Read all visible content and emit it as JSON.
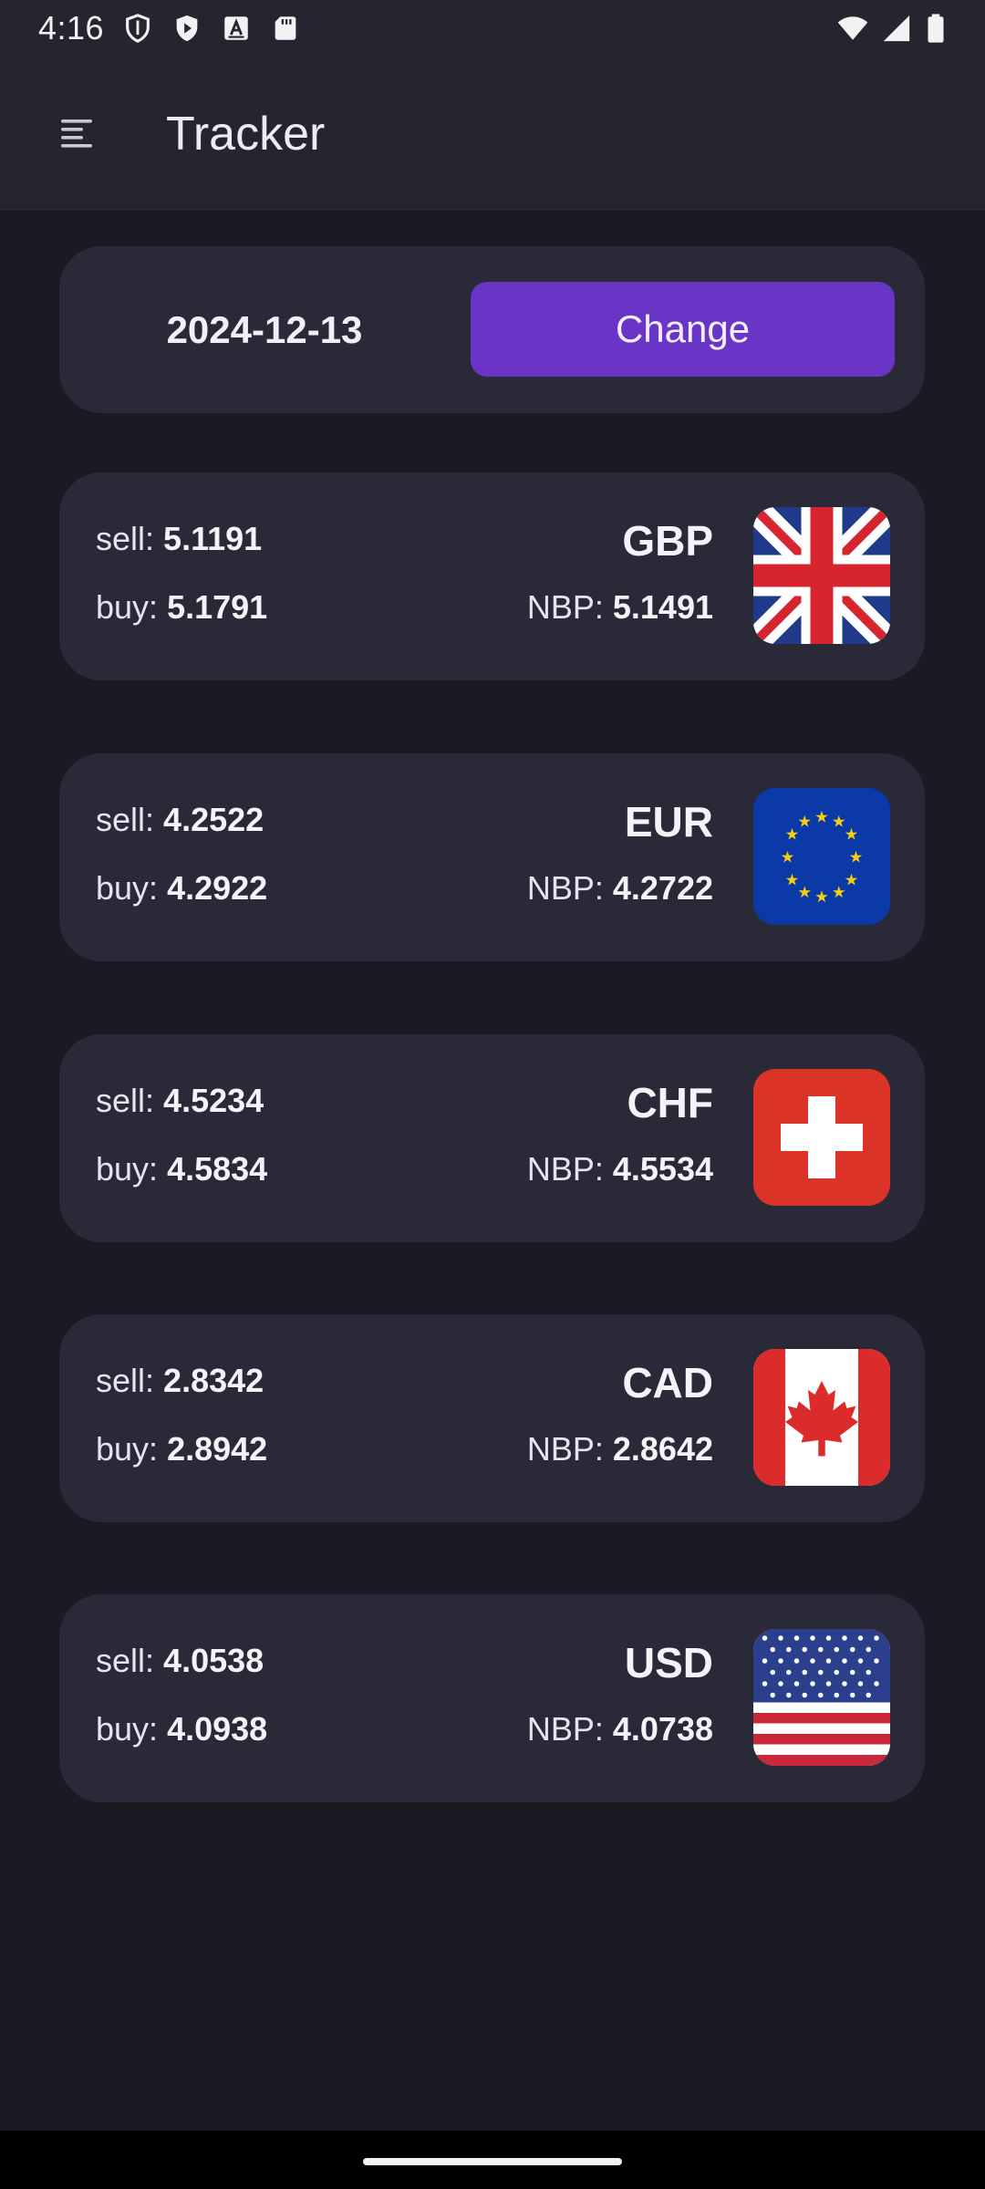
{
  "status_bar": {
    "time": "4:16",
    "left_icons": [
      "shield-icon",
      "play-store-icon",
      "font-a-icon",
      "sd-card-icon"
    ],
    "right_icons": [
      "wifi-icon",
      "signal-icon",
      "battery-icon"
    ]
  },
  "app_bar": {
    "menu_icon": "menu-icon",
    "title": "Tracker"
  },
  "date_selector": {
    "date": "2024-12-13",
    "change_label": "Change",
    "button_color": "#6a35c6"
  },
  "labels": {
    "sell": "sell:",
    "buy": "buy:",
    "nbp": "NBP:"
  },
  "currencies": [
    {
      "code": "GBP",
      "sell": "5.1191",
      "buy": "5.1791",
      "nbp": "5.1491",
      "flag": "uk-flag-icon"
    },
    {
      "code": "EUR",
      "sell": "4.2522",
      "buy": "4.2922",
      "nbp": "4.2722",
      "flag": "eu-flag-icon"
    },
    {
      "code": "CHF",
      "sell": "4.5234",
      "buy": "4.5834",
      "nbp": "4.5534",
      "flag": "swiss-flag-icon"
    },
    {
      "code": "CAD",
      "sell": "2.8342",
      "buy": "2.8942",
      "nbp": "2.8642",
      "flag": "canada-flag-icon"
    },
    {
      "code": "USD",
      "sell": "4.0538",
      "buy": "4.0938",
      "nbp": "4.0738",
      "flag": "us-flag-icon"
    }
  ]
}
